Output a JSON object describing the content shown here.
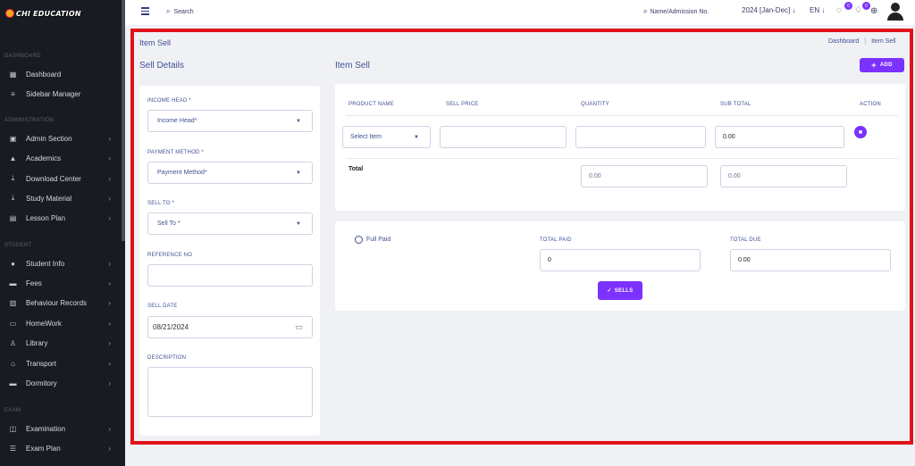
{
  "app": {
    "logo_text": "CHI EDUCATION"
  },
  "sidebar": {
    "sections": [
      {
        "label": "DASHBOARD"
      },
      {
        "label": "ADMINISTRATION"
      },
      {
        "label": "STUDENT"
      },
      {
        "label": "EXAM"
      }
    ],
    "items": [
      {
        "label": "Dashboard",
        "icon": "grid-icon",
        "chevron": false
      },
      {
        "label": "Sidebar Manager",
        "icon": "menu-icon",
        "chevron": false
      },
      {
        "label": "Admin Section",
        "icon": "admin-icon",
        "chevron": true
      },
      {
        "label": "Academics",
        "icon": "graduation-cap-icon",
        "chevron": true
      },
      {
        "label": "Download Center",
        "icon": "download-icon",
        "chevron": true
      },
      {
        "label": "Study Material",
        "icon": "download-icon",
        "chevron": true
      },
      {
        "label": "Lesson Plan",
        "icon": "lesson-icon",
        "chevron": true
      },
      {
        "label": "Student Info",
        "icon": "user-icon",
        "chevron": true
      },
      {
        "label": "Fees",
        "icon": "money-icon",
        "chevron": true
      },
      {
        "label": "Behaviour Records",
        "icon": "records-icon",
        "chevron": true
      },
      {
        "label": "HomeWork",
        "icon": "book-icon",
        "chevron": true
      },
      {
        "label": "Library",
        "icon": "library-icon",
        "chevron": true
      },
      {
        "label": "Transport",
        "icon": "transport-icon",
        "chevron": true
      },
      {
        "label": "Dormitory",
        "icon": "bed-icon",
        "chevron": true
      },
      {
        "label": "Examination",
        "icon": "map-icon",
        "chevron": true
      },
      {
        "label": "Exam Plan",
        "icon": "list-icon",
        "chevron": true
      }
    ]
  },
  "topbar": {
    "search_label": "Search",
    "name_search_label": "Name/Admission No.",
    "session": "2024 [Jan-Dec]",
    "language": "EN",
    "message_count": "0",
    "notification_count": "0"
  },
  "page": {
    "title": "Item Sell",
    "breadcrumb": [
      "Dashboard",
      "Item Sell"
    ],
    "breadcrumb_sep": "|"
  },
  "sell_details": {
    "title": "Sell Details",
    "income_head_label": "INCOME HEAD *",
    "income_head_value": "Income Head*",
    "payment_method_label": "PAYMENT METHOD *",
    "payment_method_value": "Payment Method*",
    "sell_to_label": "SELL TO *",
    "sell_to_value": "Sell To *",
    "reference_label": "REFERENCE NO",
    "reference_value": "",
    "sell_date_label": "SELL DATE",
    "sell_date_value": "08/21/2024",
    "description_label": "DESCRIPTION",
    "description_value": ""
  },
  "item_sell": {
    "title": "Item Sell",
    "add_label": "ADD",
    "columns": [
      "PRODUCT NAME",
      "SELL PRICE",
      "QUANTITY",
      "SUB TOTAL",
      "ACTION"
    ],
    "row": {
      "product": "Select Item",
      "sell_price": "",
      "quantity": "",
      "sub_total": "0.00"
    },
    "total_label": "Total",
    "total_quantity": "0.00",
    "total_amount": "0.00"
  },
  "payment": {
    "full_paid_label": "Full Paid",
    "total_paid_label": "TOTAL PAID",
    "total_paid_value": "0",
    "total_due_label": "TOTAL DUE",
    "total_due_value": "0.00",
    "sells_label": "SELLS"
  },
  "colors": {
    "accent": "#7c32ff",
    "highlight": "#e0141a",
    "sidebar": "#191b22",
    "text": "#415094"
  }
}
